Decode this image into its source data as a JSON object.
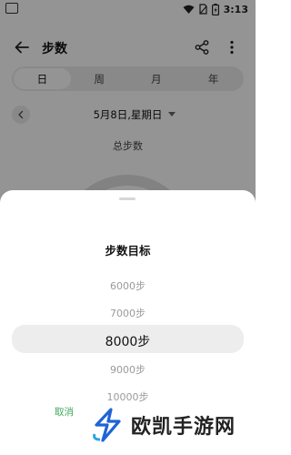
{
  "status_bar": {
    "time": "3:13"
  },
  "header": {
    "title": "步数",
    "back_icon": "arrow-left-icon",
    "share_icon": "share-icon",
    "more_icon": "more-vertical-icon"
  },
  "tabs": [
    {
      "label": "日",
      "active": true
    },
    {
      "label": "周",
      "active": false
    },
    {
      "label": "月",
      "active": false
    },
    {
      "label": "年",
      "active": false
    }
  ],
  "date_nav": {
    "date": "5月8日,星期日"
  },
  "summary": {
    "total_label": "总步数"
  },
  "goal_sheet": {
    "title": "步数目标",
    "options": [
      "6000步",
      "7000步",
      "8000步",
      "9000步",
      "10000步"
    ],
    "selected": "8000步",
    "cancel_label": "取消"
  },
  "watermark": {
    "brand": "欧凯手游网"
  },
  "colors": {
    "accent": "#3fa55a",
    "overlay": "rgba(0,0,0,0.42)"
  }
}
